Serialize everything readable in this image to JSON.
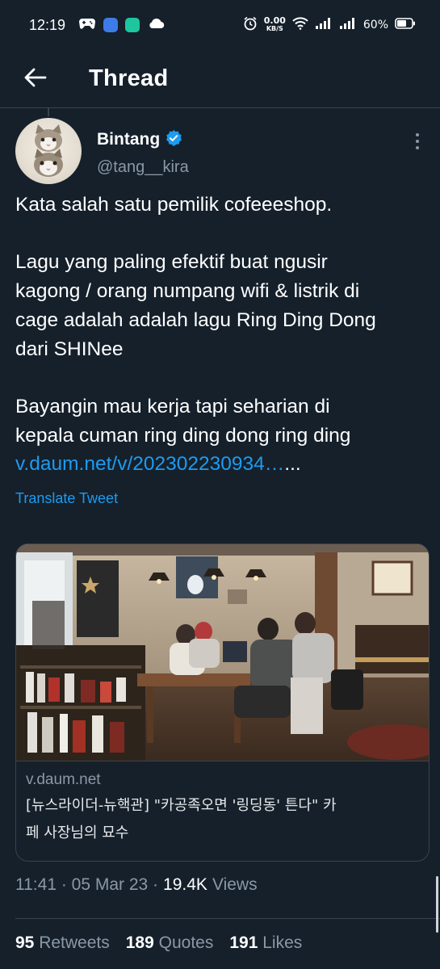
{
  "status_bar": {
    "time": "12:19",
    "net_speed_value": "0.00",
    "net_speed_unit": "KB/S",
    "battery": "60%"
  },
  "header": {
    "title": "Thread"
  },
  "tweet": {
    "author_name": "Bintang",
    "author_handle": "@tang__kira",
    "text_lines": [
      "Kata salah satu pemilik cofeeeshop.",
      "Lagu yang paling efektif buat ngusir",
      "kagong / orang numpang wifi & listrik di",
      "cage adalah adalah lagu Ring Ding Dong",
      "dari SHINee",
      "Bayangin mau kerja tapi seharian di",
      "kepala cuman ring ding dong ring ding"
    ],
    "link_text": "v.daum.net/v/202302230934…",
    "link_suffix": "...",
    "translate_label": "Translate Tweet",
    "card": {
      "domain": "v.daum.net",
      "title_line1": "[뉴스라이더-뉴핵관] \"카공족오면 '링딩동' 튼다\" 카",
      "title_line2": "페 사장님의 묘수"
    },
    "timestamp": "11:41 · 05 Mar 23 · ",
    "views_count": "19.4K",
    "views_label": "Views",
    "stats": {
      "retweets_count": "95",
      "retweets_label": "Retweets",
      "quotes_count": "189",
      "quotes_label": "Quotes",
      "likes_count": "191",
      "likes_label": "Likes"
    }
  },
  "colors": {
    "background": "#15202b",
    "accent": "#1d9bf0",
    "secondary_text": "#8b98a5",
    "divider": "#38444d"
  },
  "icons": [
    "gamepad-icon",
    "app-icon-blue",
    "app-icon-green",
    "cloud-icon",
    "alarm-icon",
    "wifi-icon",
    "signal-icon",
    "battery-icon",
    "back-arrow-icon",
    "verified-badge-icon",
    "more-vertical-icon"
  ]
}
